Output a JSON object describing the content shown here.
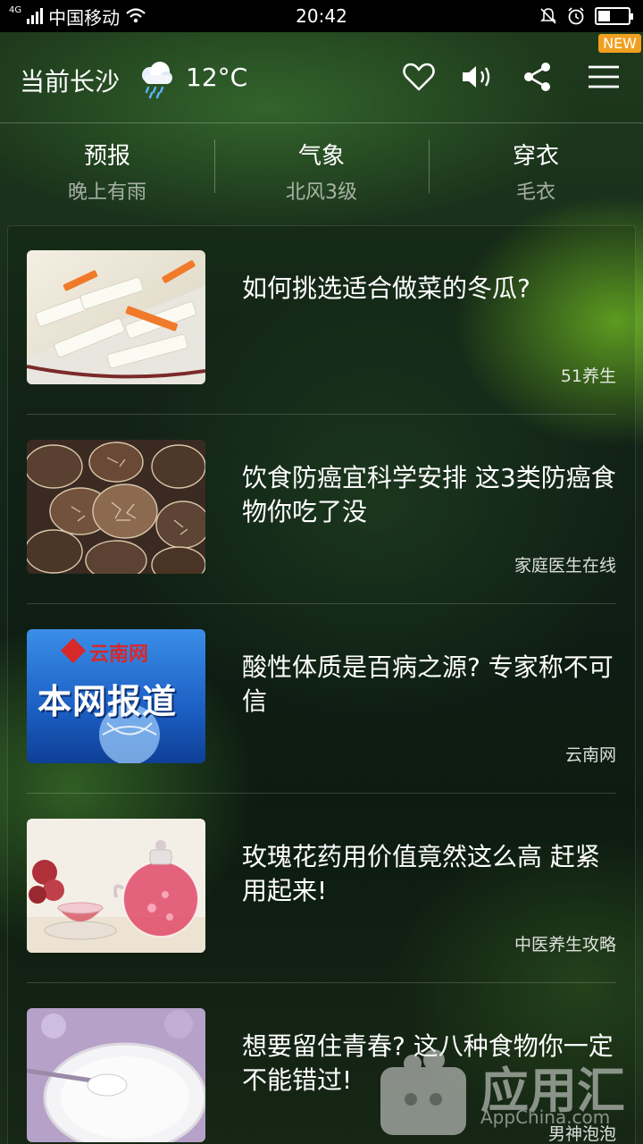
{
  "status_bar": {
    "network": "4G",
    "carrier": "中国移动",
    "time": "20:42"
  },
  "header": {
    "location": "当前长沙",
    "weather_icon": "rain-cloud-icon",
    "temperature": "12°C",
    "new_badge": "NEW",
    "icons": [
      "heart-icon",
      "speaker-icon",
      "share-icon",
      "menu-icon"
    ]
  },
  "info": [
    {
      "title": "预报",
      "sub": "晚上有雨"
    },
    {
      "title": "气象",
      "sub": "北风3级"
    },
    {
      "title": "穿衣",
      "sub": "毛衣"
    }
  ],
  "news": [
    {
      "title": "如何挑选适合做菜的冬瓜?",
      "source": "51养生",
      "image": "winter-melon-dish"
    },
    {
      "title": "饮食防癌宜科学安排 这3类防癌食物你吃了没",
      "source": "家庭医生在线",
      "image": "shiitake-mushrooms"
    },
    {
      "title": "酸性体质是百病之源? 专家称不可信",
      "source": "云南网",
      "image": "yunnan-news-report",
      "image_text": {
        "brand": "云南网",
        "headline": "本网报道"
      }
    },
    {
      "title": "玫瑰花药用价值竟然这么高 赶紧用起来!",
      "source": "中医养生攻略",
      "image": "rose-tea"
    },
    {
      "title": "想要留住青春? 这八种食物你一定不能错过!",
      "source": "男神泡泡",
      "image": "yogurt-bowl"
    }
  ],
  "watermark": {
    "name": "应用汇",
    "domain": "AppChina.com"
  },
  "colors": {
    "accent_badge": "#f0a020",
    "status_bar": "#000000"
  }
}
